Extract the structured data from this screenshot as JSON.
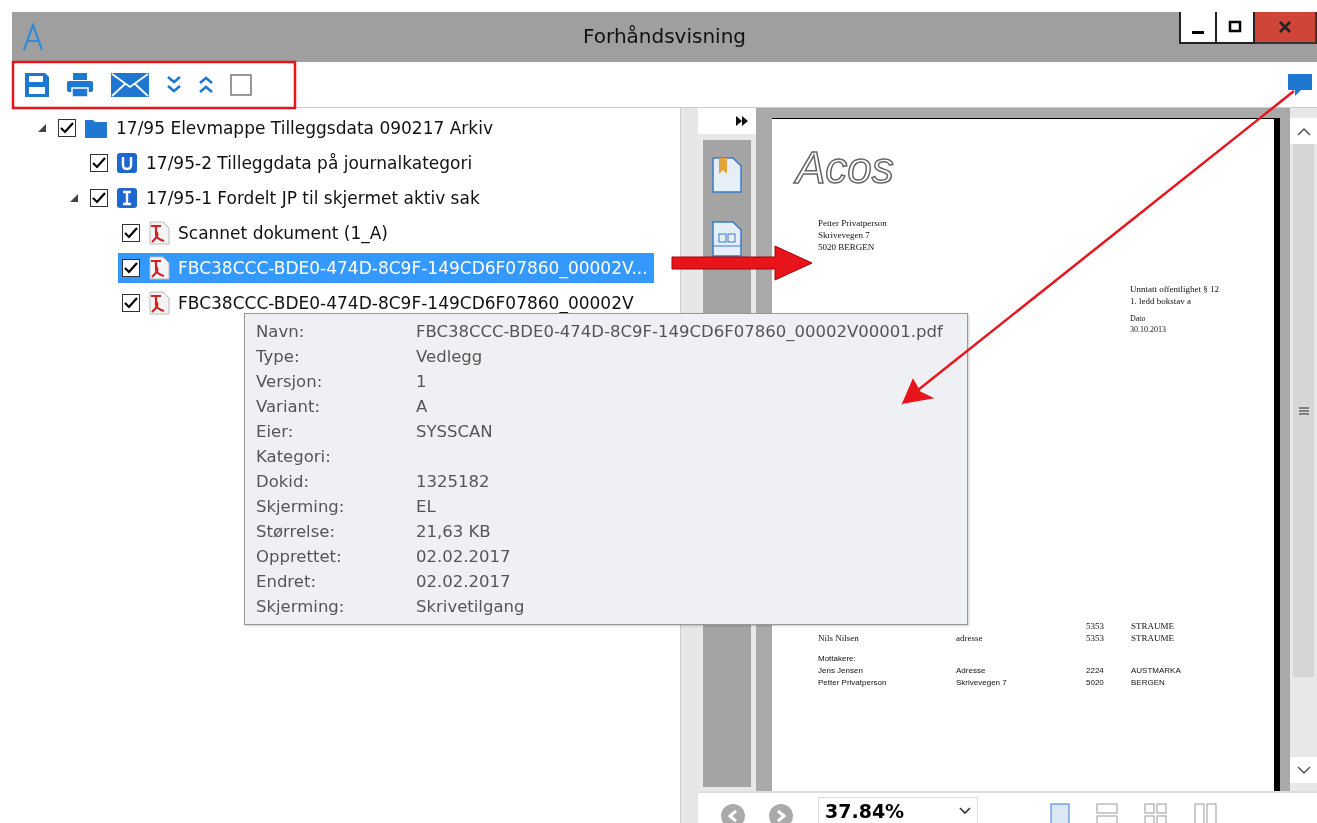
{
  "window": {
    "title": "Forhåndsvisning"
  },
  "toolbar": {
    "checkbox": {
      "checked": false
    }
  },
  "tree": [
    {
      "label": "17/95 Elevmappe Tilleggsdata 090217 Arkiv",
      "kind": "folder",
      "checked": true,
      "selected": false,
      "expanded": true,
      "children": [
        {
          "label": "17/95-2 Tilleggdata på journalkategori",
          "kind": "u-doc",
          "checked": true,
          "selected": false
        },
        {
          "label": "17/95-1 Fordelt JP til skjermet aktiv sak",
          "kind": "i-doc",
          "checked": true,
          "selected": false,
          "expanded": true,
          "children": [
            {
              "label": "Scannet dokument (1_A)",
              "kind": "pdf",
              "checked": true,
              "selected": false
            },
            {
              "label": "FBC38CCC-BDE0-474D-8C9F-149CD6F07860_00002V...",
              "kind": "pdf",
              "checked": true,
              "selected": true
            },
            {
              "label": "FBC38CCC-BDE0-474D-8C9F-149CD6F07860_00002V",
              "kind": "pdf",
              "checked": true,
              "selected": false
            }
          ]
        }
      ]
    }
  ],
  "tooltip": [
    {
      "label": "Navn:",
      "value": "FBC38CCC-BDE0-474D-8C9F-149CD6F07860_00002V00001.pdf"
    },
    {
      "label": "Type:",
      "value": "Vedlegg"
    },
    {
      "label": "Versjon:",
      "value": "1"
    },
    {
      "label": "Variant:",
      "value": "A"
    },
    {
      "label": "Eier:",
      "value": "SYSSCAN"
    },
    {
      "label": "Kategori:"
    },
    {
      "label": "Dokid:",
      "value": "1325182"
    },
    {
      "label": "Skjerming:",
      "value": "EL"
    },
    {
      "label": "Størrelse:",
      "value": "21,63 KB"
    },
    {
      "label": "Opprettet:",
      "value": "02.02.2017"
    },
    {
      "label": "Endret:",
      "value": "02.02.2017"
    },
    {
      "label": "Skjerming:",
      "value": "Skrivetilgang"
    }
  ],
  "document": {
    "logo": "Acos",
    "address": [
      "Petter Privatperson",
      "Skrivevegen 7",
      "5020 BERGEN"
    ],
    "notice": [
      "Unntatt offentlighet § 12",
      "1. ledd bokstav a"
    ],
    "date_label": "Dato",
    "date": "30.10.2013",
    "copy_rows": [
      {
        "cells": [
          "",
          "",
          "5353",
          "STRAUME"
        ]
      },
      {
        "cells": [
          "Nils Nilsen",
          "adresse",
          "5353",
          "STRAUME"
        ]
      }
    ],
    "recipients_label": "Mottakere:",
    "recipient_rows": [
      {
        "cells": [
          "Jens Jensen",
          "Adresse",
          "2224",
          "AUSTMARKA"
        ]
      },
      {
        "cells": [
          "Petter Privatperson",
          "Skrivevegen 7",
          "5020",
          "BERGEN"
        ]
      }
    ]
  },
  "zoom": "37.84%"
}
